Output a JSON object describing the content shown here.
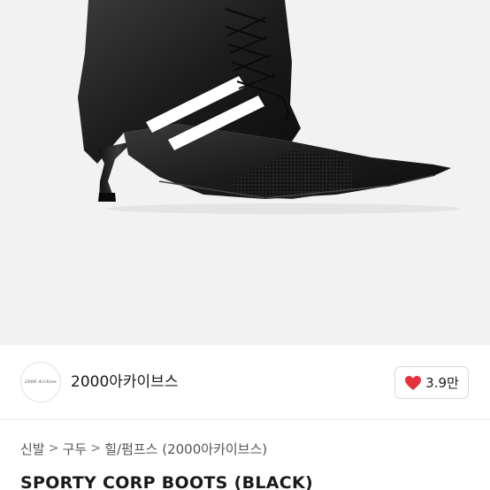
{
  "shop": {
    "logo_text": "2000 Archive",
    "name": "2000아카이브스"
  },
  "like": {
    "count": "3.9만",
    "icon": "heart-icon",
    "color": "#e5323e"
  },
  "breadcrumb": {
    "items": [
      "신발",
      "구두",
      "힐/펌프스 (2000아카이브스)"
    ],
    "separator": ">"
  },
  "product": {
    "title": "SPORTY CORP BOOTS (BLACK)",
    "image_icon": "boot-image"
  }
}
